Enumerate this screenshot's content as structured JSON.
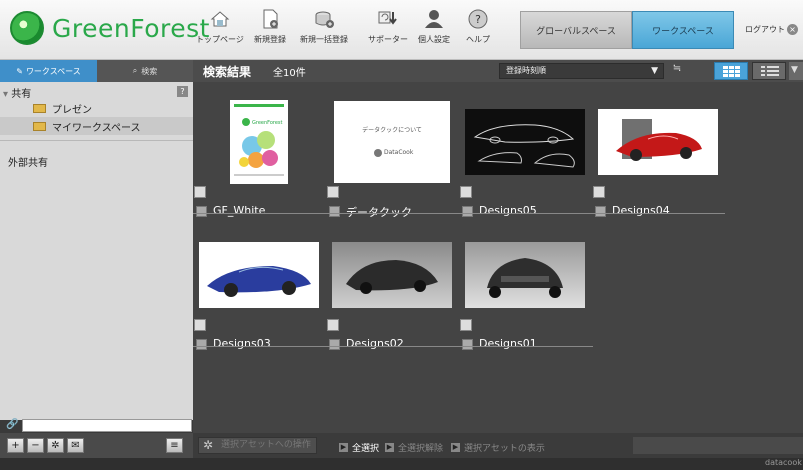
{
  "header": {
    "brand": "GreenForest",
    "nav": [
      {
        "label": "トップページ",
        "icon": "home-icon"
      },
      {
        "label": "新規登録",
        "icon": "new-document-icon"
      },
      {
        "label": "新規一括登録",
        "icon": "bulk-register-icon"
      },
      {
        "label": "サポーター",
        "icon": "supporter-icon"
      },
      {
        "label": "個人設定",
        "icon": "user-icon"
      },
      {
        "label": "ヘルプ",
        "icon": "help-icon"
      }
    ],
    "global_space": "グローバルスペース",
    "workspace": "ワークスペース",
    "logout": "ログアウト"
  },
  "sidebar": {
    "tab_workspace": "ワークスペース",
    "tab_search": "検索",
    "root": "共有",
    "help": "?",
    "items": [
      {
        "label": "プレゼン",
        "icon": "folder-icon"
      },
      {
        "label": "マイワークスペース",
        "icon": "folder-icon"
      }
    ],
    "external": "外部共有"
  },
  "content": {
    "title": "検索結果",
    "count": "全10件",
    "sort": "登録時刻順",
    "assets": [
      {
        "name": "GF_White",
        "type": "document"
      },
      {
        "name": "データクック",
        "type": "document"
      },
      {
        "name": "Designs05",
        "type": "image"
      },
      {
        "name": "Designs04",
        "type": "image"
      },
      {
        "name": "Designs03",
        "type": "image"
      },
      {
        "name": "Designs02",
        "type": "image"
      },
      {
        "name": "Designs01",
        "type": "image"
      }
    ],
    "doc2_title": "データクックについて",
    "doc2_brand": "DataCook"
  },
  "bottom": {
    "operation": "選択アセットへの操作",
    "select_all": "全選択",
    "deselect_all": "全選択解除",
    "show_selected": "選択アセットの表示"
  },
  "footer": {
    "brand": "datacook"
  },
  "colors": {
    "accent_blue": "#4aa3d9",
    "brand_green": "#2aa84a"
  }
}
